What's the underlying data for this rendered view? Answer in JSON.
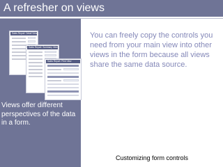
{
  "slide": {
    "title": "A refresher on views",
    "body_text": "You can freely copy the controls you need from your main view into other views in the form because all views share the same data source.",
    "caption": "Views offer different perspectives of the data in a form.",
    "footer": "Customizing form controls"
  },
  "thumbnails": [
    {
      "header": "Sales Report: Detail View"
    },
    {
      "header": "Sales Report: Summary View"
    },
    {
      "header": "Sales Report: Print View"
    }
  ],
  "colors": {
    "title_bar": "#6f7496",
    "left_panel": "#6f7496",
    "body_text": "#8488b8"
  }
}
